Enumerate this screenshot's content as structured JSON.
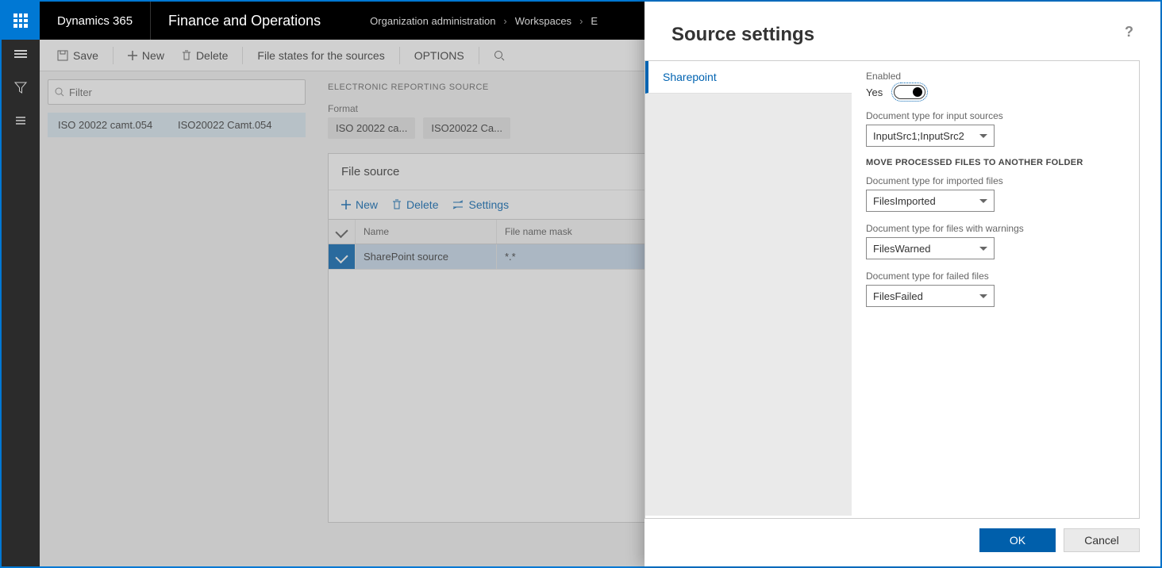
{
  "topbar": {
    "brand": "Dynamics 365",
    "module": "Finance and Operations",
    "breadcrumb": [
      "Organization administration",
      "Workspaces",
      "E"
    ]
  },
  "actions": {
    "save": "Save",
    "new": "New",
    "delete": "Delete",
    "file_states": "File states for the sources",
    "options": "OPTIONS"
  },
  "list": {
    "filter_placeholder": "Filter",
    "rows": [
      {
        "c1": "ISO 20022 camt.054",
        "c2": "ISO20022 Camt.054"
      }
    ]
  },
  "detail": {
    "section": "ELECTRONIC REPORTING SOURCE",
    "format_label": "Format",
    "format_chips": [
      "ISO 20022 ca...",
      "ISO20022 Ca..."
    ],
    "card_title": "File source",
    "tools": {
      "new": "New",
      "delete": "Delete",
      "settings": "Settings"
    },
    "grid": {
      "headers": {
        "name": "Name",
        "mask": "File name mask"
      },
      "rows": [
        {
          "name": "SharePoint source",
          "mask": "*.*",
          "selected": true
        }
      ]
    }
  },
  "flyout": {
    "title": "Source settings",
    "nav": [
      "Sharepoint"
    ],
    "enabled_label": "Enabled",
    "enabled_value": "Yes",
    "input_sources_label": "Document type for input sources",
    "input_sources_value": "InputSrc1;InputSrc2",
    "subhead": "MOVE PROCESSED FILES TO ANOTHER FOLDER",
    "imported_label": "Document type for imported files",
    "imported_value": "FilesImported",
    "warned_label": "Document type for files with warnings",
    "warned_value": "FilesWarned",
    "failed_label": "Document type for failed files",
    "failed_value": "FilesFailed",
    "buttons": {
      "ok": "OK",
      "cancel": "Cancel"
    }
  }
}
